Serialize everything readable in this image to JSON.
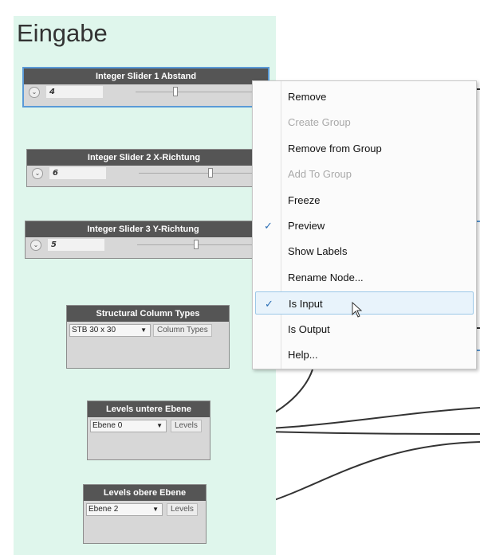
{
  "group": {
    "title": "Eingabe"
  },
  "nodes": {
    "slider1": {
      "title": "Integer Slider 1 Abstand",
      "value": "4",
      "fraction": 0.31
    },
    "slider2": {
      "title": "Integer Slider 2 X-Richtung",
      "value": "6",
      "fraction": 0.6
    },
    "slider3": {
      "title": "Integer Slider 3 Y-Richtung",
      "value": "5",
      "fraction": 0.49
    },
    "column_types": {
      "title": "Structural Column Types",
      "selected": "STB 30 x 30",
      "output": "Column Types"
    },
    "levels_lower": {
      "title": "Levels untere Ebene",
      "selected": "Ebene 0",
      "output": "Levels"
    },
    "levels_upper": {
      "title": "Levels obere Ebene",
      "selected": "Ebene 2",
      "output": "Levels"
    }
  },
  "menu": {
    "items": [
      {
        "label": "Remove",
        "enabled": true,
        "checked": false
      },
      {
        "label": "Create Group",
        "enabled": false,
        "checked": false
      },
      {
        "label": "Remove from Group",
        "enabled": true,
        "checked": false
      },
      {
        "label": "Add To Group",
        "enabled": false,
        "checked": false
      },
      {
        "label": "Freeze",
        "enabled": true,
        "checked": false
      },
      {
        "label": "Preview",
        "enabled": true,
        "checked": true
      },
      {
        "label": "Show Labels",
        "enabled": true,
        "checked": false
      },
      {
        "label": "Rename Node...",
        "enabled": true,
        "checked": false
      },
      {
        "label": "Is Input",
        "enabled": true,
        "checked": true,
        "hovered": true
      },
      {
        "label": "Is Output",
        "enabled": true,
        "checked": false
      },
      {
        "label": "Help...",
        "enabled": true,
        "checked": false
      }
    ],
    "check_glyph": "✓"
  },
  "colors": {
    "group_background": "#dff6ec",
    "node_header": "#555555",
    "selection_border": "#5a9ad7",
    "check_color": "#2c6fb5"
  }
}
